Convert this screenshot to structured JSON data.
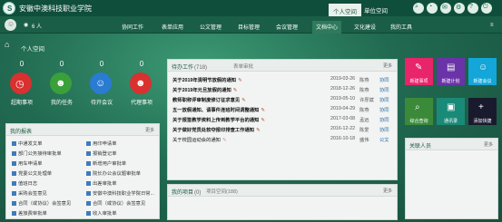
{
  "header": {
    "brand": "安徽中澳科技职业学院",
    "tabs": [
      "个人空间",
      "单位空间"
    ]
  },
  "user": {
    "name": "6 人"
  },
  "nav": [
    "协同工作",
    "表单应用",
    "公文管理",
    "目标管理",
    "会议管理",
    "文档中心",
    "文化建设",
    "我的工具"
  ],
  "section": {
    "title": "个人空间"
  },
  "tiles": [
    {
      "count": "0",
      "label": "超期事项",
      "color": "#d93030",
      "icon": "clock-icon"
    },
    {
      "count": "0",
      "label": "我的任务",
      "color": "#3aa03a",
      "icon": "person-icon"
    },
    {
      "count": "0",
      "label": "待开会议",
      "color": "#2a7bd2",
      "icon": "people-icon"
    },
    {
      "count": "0",
      "label": "代理事项",
      "color": "#d93030",
      "icon": "person-icon"
    }
  ],
  "reports": {
    "title": "我的报表",
    "more": "更多",
    "items": [
      "中通发文单",
      "部门公务接待审批单",
      "用车申请单",
      "党委公文处理单",
      "值班日志",
      "采购会签意见",
      "合同（或协议）会签意见",
      "差旅费审批单",
      "用印申请单",
      "报销登记单",
      "新增用户审批单",
      "院长办公会议题审批单",
      "出差审批单",
      "安徽中澳科技职业学院日常...",
      "合同（或协议）会签意见",
      "收入审批单"
    ]
  },
  "todo": {
    "title": "待办工作",
    "count": "(718)",
    "tab2": "表单审批",
    "more": "更多",
    "rows": [
      {
        "title": "关于2019年清明节放假的通知",
        "date": "2019-03-26",
        "person": "陈燕",
        "link": "协同"
      },
      {
        "title": "关于2019年元旦放假的通知",
        "date": "2018-12-26",
        "person": "陈燕",
        "link": "协同"
      },
      {
        "title": "教师职称评审制度修订征求意见",
        "date": "2019-05-10",
        "person": "许厚斌",
        "link": "协同"
      },
      {
        "title": "五一放假通知、请事件连班时间调整通知",
        "date": "2019-04-29",
        "person": "陈燕",
        "link": "协同"
      },
      {
        "title": "关于报签教学资料上传到教学平台的通知",
        "date": "2017-03-08",
        "person": "孟远",
        "link": "协同"
      },
      {
        "title": "关于做好党员处软夺报印排查工作通知",
        "date": "2016-12-22",
        "person": "陈爱",
        "link": "协同"
      },
      {
        "title": "关于校园运动会的通知",
        "date": "2016-10-18",
        "person": "盛伟",
        "link": "公文"
      }
    ]
  },
  "projects": {
    "title": "我的项目",
    "count": "(0)",
    "tab2": "项目空间(188)",
    "more": "更多"
  },
  "apps": [
    {
      "label": "新建事项",
      "color": "#e8246a",
      "icon": "new-item-icon"
    },
    {
      "label": "新建计划",
      "color": "#6a33a8",
      "icon": "plan-icon"
    },
    {
      "label": "新建会议",
      "color": "#13a6d8",
      "icon": "meeting-icon"
    },
    {
      "label": "综合查询",
      "color": "#3a8a3a",
      "icon": "search-icon"
    },
    {
      "label": "通讯录",
      "color": "#1a8a78",
      "icon": "contacts-icon"
    },
    {
      "label": "添加快捷",
      "color": "#1a1a2e",
      "icon": "plus-icon"
    }
  ],
  "related": {
    "title": "关联人员",
    "more": "更多"
  }
}
